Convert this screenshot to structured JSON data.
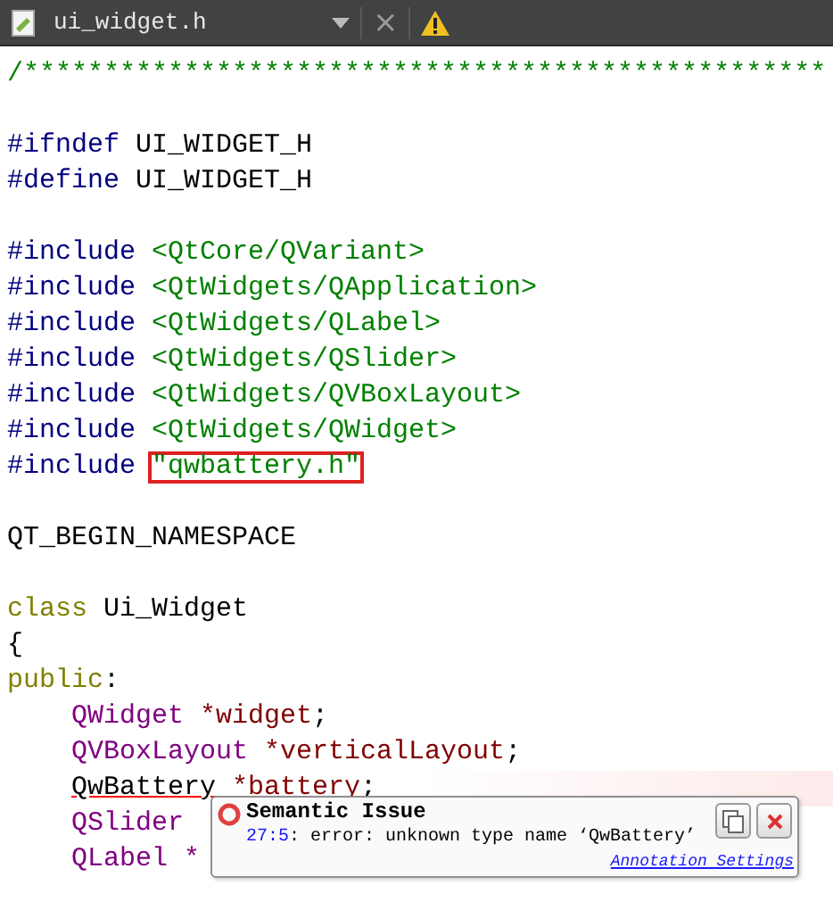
{
  "tab": {
    "filename": "ui_widget.h",
    "close": "×"
  },
  "lines": [
    {
      "kind": "code",
      "indented": false,
      "error": false,
      "tokens": [
        {
          "text": "/**************************************************",
          "kind": "comment",
          "highlighted": false
        }
      ]
    },
    {
      "kind": "blank"
    },
    {
      "kind": "code",
      "indented": false,
      "error": false,
      "tokens": [
        {
          "text": "#ifndef ",
          "kind": "preproc",
          "highlighted": false
        },
        {
          "text": "UI_WIDGET_H",
          "kind": "plain",
          "highlighted": false
        }
      ]
    },
    {
      "kind": "code",
      "indented": false,
      "error": false,
      "tokens": [
        {
          "text": "#define ",
          "kind": "preproc",
          "highlighted": false
        },
        {
          "text": "UI_WIDGET_H",
          "kind": "plain",
          "highlighted": false
        }
      ]
    },
    {
      "kind": "blank"
    },
    {
      "kind": "code",
      "indented": false,
      "error": false,
      "tokens": [
        {
          "text": "#include ",
          "kind": "preproc",
          "highlighted": false
        },
        {
          "text": "<QtCore/QVariant>",
          "kind": "path",
          "highlighted": false
        }
      ]
    },
    {
      "kind": "code",
      "indented": false,
      "error": false,
      "tokens": [
        {
          "text": "#include ",
          "kind": "preproc",
          "highlighted": false
        },
        {
          "text": "<QtWidgets/QApplication>",
          "kind": "path",
          "highlighted": false
        }
      ]
    },
    {
      "kind": "code",
      "indented": false,
      "error": false,
      "tokens": [
        {
          "text": "#include ",
          "kind": "preproc",
          "highlighted": false
        },
        {
          "text": "<QtWidgets/QLabel>",
          "kind": "path",
          "highlighted": false
        }
      ]
    },
    {
      "kind": "code",
      "indented": false,
      "error": false,
      "tokens": [
        {
          "text": "#include ",
          "kind": "preproc",
          "highlighted": false
        },
        {
          "text": "<QtWidgets/QSlider>",
          "kind": "path",
          "highlighted": false
        }
      ]
    },
    {
      "kind": "code",
      "indented": false,
      "error": false,
      "tokens": [
        {
          "text": "#include ",
          "kind": "preproc",
          "highlighted": false
        },
        {
          "text": "<QtWidgets/QVBoxLayout>",
          "kind": "path",
          "highlighted": false
        }
      ]
    },
    {
      "kind": "code",
      "indented": false,
      "error": false,
      "tokens": [
        {
          "text": "#include ",
          "kind": "preproc",
          "highlighted": false
        },
        {
          "text": "<QtWidgets/QWidget>",
          "kind": "path",
          "highlighted": false
        }
      ]
    },
    {
      "kind": "code",
      "indented": false,
      "error": false,
      "tokens": [
        {
          "text": "#include ",
          "kind": "preproc",
          "highlighted": false
        },
        {
          "text": "\"qwbattery.h\"",
          "kind": "path",
          "highlighted": true
        }
      ]
    },
    {
      "kind": "blank"
    },
    {
      "kind": "code",
      "indented": false,
      "error": false,
      "tokens": [
        {
          "text": "QT_BEGIN_NAMESPACE",
          "kind": "plain",
          "highlighted": false
        }
      ]
    },
    {
      "kind": "blank"
    },
    {
      "kind": "code",
      "indented": false,
      "error": false,
      "tokens": [
        {
          "text": "class ",
          "kind": "keyword",
          "highlighted": false
        },
        {
          "text": "Ui_Widget",
          "kind": "plain",
          "highlighted": false
        }
      ]
    },
    {
      "kind": "code",
      "indented": false,
      "error": false,
      "tokens": [
        {
          "text": "{",
          "kind": "plain",
          "highlighted": false
        }
      ]
    },
    {
      "kind": "code",
      "indented": false,
      "error": false,
      "tokens": [
        {
          "text": "public",
          "kind": "keyword",
          "highlighted": false
        },
        {
          "text": ":",
          "kind": "plain",
          "highlighted": false
        }
      ]
    },
    {
      "kind": "code",
      "indented": true,
      "error": false,
      "tokens": [
        {
          "text": "QWidget ",
          "kind": "type",
          "highlighted": false
        },
        {
          "text": "*widget",
          "kind": "field",
          "highlighted": false
        },
        {
          "text": ";",
          "kind": "plain",
          "highlighted": false
        }
      ]
    },
    {
      "kind": "code",
      "indented": true,
      "error": false,
      "tokens": [
        {
          "text": "QVBoxLayout ",
          "kind": "type",
          "highlighted": false
        },
        {
          "text": "*verticalLayout",
          "kind": "field",
          "highlighted": false
        },
        {
          "text": ";",
          "kind": "plain",
          "highlighted": false
        }
      ]
    },
    {
      "kind": "code",
      "indented": true,
      "error": true,
      "tokens": [
        {
          "text": "QwBattery",
          "kind": "plain",
          "highlighted": false
        },
        {
          "text": " *battery",
          "kind": "field",
          "highlighted": false
        },
        {
          "text": ";",
          "kind": "plain",
          "highlighted": false
        }
      ]
    },
    {
      "kind": "code",
      "indented": true,
      "error": false,
      "tokens": [
        {
          "text": "QSlider",
          "kind": "type",
          "highlighted": false
        }
      ]
    },
    {
      "kind": "code",
      "indented": true,
      "error": false,
      "tokens": [
        {
          "text": "QLabel *",
          "kind": "type",
          "highlighted": false
        }
      ]
    }
  ],
  "tooltip": {
    "title": "Semantic Issue",
    "location": "27:5",
    "message": ": error: unknown type name ‘QwBattery’",
    "link": "Annotation Settings"
  }
}
